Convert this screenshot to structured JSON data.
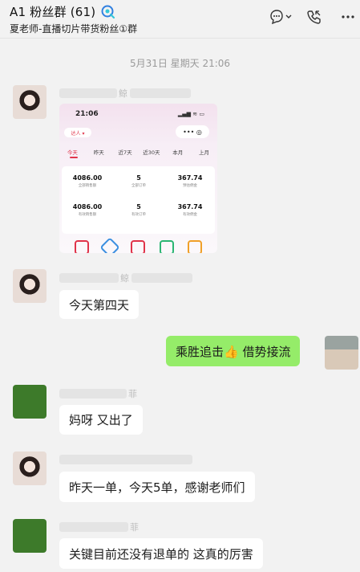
{
  "header": {
    "title": "A1 粉丝群 (61)",
    "subtitle": "夏老师-直播切片带货粉丝①群",
    "icons": [
      "group-chat-icon",
      "chat-bubble-icon",
      "chevron-down-icon",
      "phone-icon",
      "more-icon"
    ]
  },
  "time_separator": "5月31日 星期天 21:06",
  "messages": [
    {
      "sender_fragment": "鲸",
      "type": "image"
    },
    {
      "sender_fragment": "鲸",
      "text": "今天第四天"
    },
    {
      "me": true,
      "text": "乘胜追击👍 借势接流"
    },
    {
      "sender_fragment": "菲",
      "text": "妈呀 又出了"
    },
    {
      "sender_fragment": "",
      "text": "昨天一单，今天5单，感谢老师们"
    },
    {
      "sender_fragment": "菲",
      "text": "关键目前还没有退单的 这真的厉害"
    }
  ],
  "screenshot_card": {
    "time": "21:06",
    "status": "▂▄▆ ≋ ▭",
    "role": "达人 ▾",
    "more": "•••  ◎",
    "tabs": [
      "今天",
      "昨天",
      "近7天",
      "近30天",
      "本月",
      "上月"
    ],
    "stats": [
      {
        "value": "4086.00",
        "label": "全部销售额"
      },
      {
        "value": "5",
        "label": "全部订单"
      },
      {
        "value": "367.74",
        "label": "预估佣金"
      },
      {
        "value": "4086.00",
        "label": "有效销售额"
      },
      {
        "value": "5",
        "label": "有效订单"
      },
      {
        "value": "367.74",
        "label": "有效佣金"
      }
    ],
    "bottom_icon_colors": [
      "#e0344a",
      "#3b8fe0",
      "#e0344a",
      "#2bb673",
      "#f0a028"
    ]
  },
  "colors": {
    "my_bubble": "#95ec69",
    "other_bubble": "#ffffff",
    "background": "#f2f2f2"
  }
}
